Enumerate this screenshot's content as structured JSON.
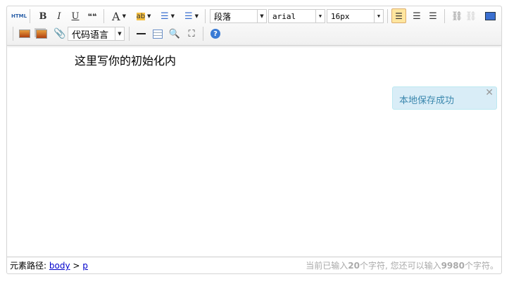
{
  "toolbar": {
    "html_label": "HTML",
    "bold": "B",
    "italic": "I",
    "underline": "U",
    "blockquote": "❝❝",
    "fontcolor": "A",
    "paragraph": "段落",
    "fontfamily": "arial",
    "fontsize": "16px",
    "code_language": "代码语言"
  },
  "content": {
    "text": "这里写你的初始化内"
  },
  "notice": {
    "text": "本地保存成功",
    "close": "✕"
  },
  "footer": {
    "path_label": "元素路径:",
    "path": [
      "body",
      "p"
    ],
    "path_sep": ">",
    "count_prefix": "当前已输入",
    "count": "20",
    "count_mid": "个字符, 您还可以输入",
    "remaining": "9980",
    "count_suffix": "个字符。"
  },
  "colors": {
    "notice_bg": "#d9edf7",
    "notice_text": "#3a87ad",
    "active_button": "#ffe69f"
  }
}
